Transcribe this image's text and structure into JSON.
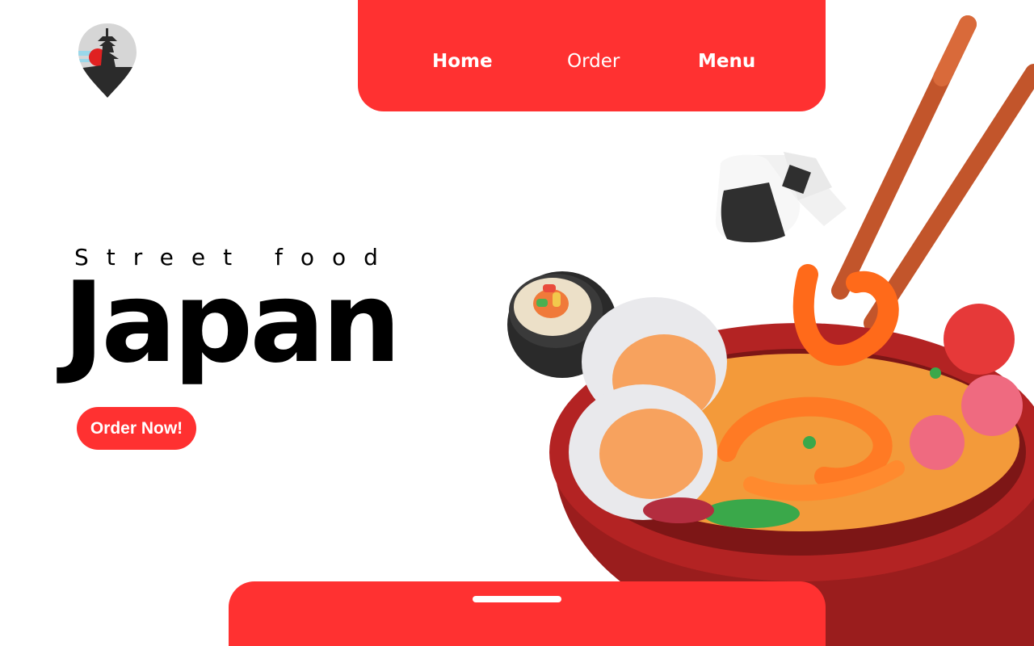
{
  "nav": {
    "home_label": "Home",
    "order_label": "Order",
    "menu_label": "Menu"
  },
  "hero": {
    "subtitle": "Street food",
    "title": "Japan",
    "cta_label": "Order Now!"
  },
  "icons": {
    "logo": "pagoda-location-pin-icon",
    "handle": "drag-handle-icon"
  },
  "colors": {
    "accent": "#ff3131",
    "text": "#000000",
    "background": "#ffffff"
  }
}
